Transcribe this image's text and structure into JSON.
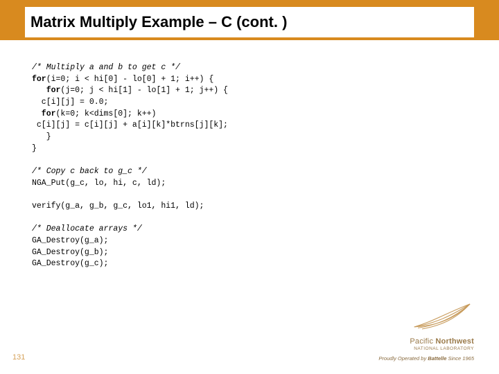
{
  "title": "Matrix Multiply Example – C (cont. )",
  "code": {
    "c1": "/* Multiply a and b to get c */",
    "l2a": "for",
    "l2b": "(i=0; i < hi[0] - lo[0] + 1; i++) {",
    "l3a": "   for",
    "l3b": "(j=0; j < hi[1] - lo[1] + 1; j++) {",
    "l4": "  c[i][j] = 0.0;",
    "l5a": "  for",
    "l5b": "(k=0; k<dims[0]; k++)",
    "l6": " c[i][j] = c[i][j] + a[i][k]*btrns[j][k];",
    "l7": "   }",
    "l8": "}",
    "c2": "/* Copy c back to g_c */",
    "l9": "NGA_Put(g_c, lo, hi, c, ld);",
    "l10": "verify(g_a, g_b, g_c, lo1, hi1, ld);",
    "c3": "/* Deallocate arrays */",
    "l11": "GA_Destroy(g_a);",
    "l12": "GA_Destroy(g_b);",
    "l13": "GA_Destroy(g_c);"
  },
  "page_number": "131",
  "footer": {
    "brand_first": "Pacific ",
    "brand_second": "Northwest",
    "brand_sub": "NATIONAL LABORATORY",
    "tagline_prefix": "Proudly Operated by ",
    "tagline_brand": "Battelle",
    "tagline_suffix": " Since 1965"
  }
}
